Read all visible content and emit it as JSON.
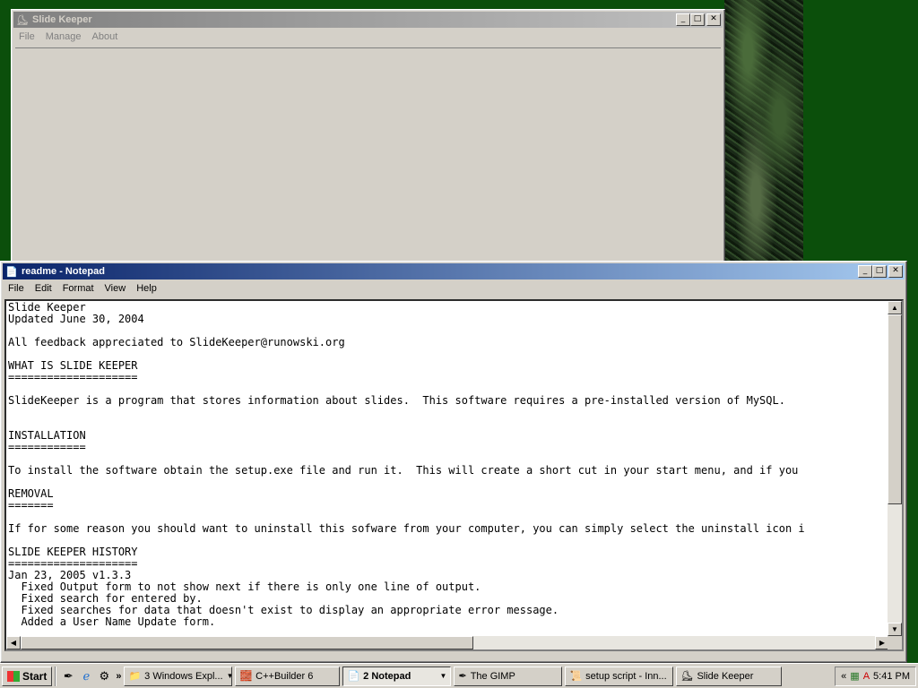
{
  "slide_keeper": {
    "title": "Slide Keeper",
    "menu": [
      "File",
      "Manage",
      "About"
    ]
  },
  "notepad": {
    "title": "readme - Notepad",
    "menu": [
      "File",
      "Edit",
      "Format",
      "View",
      "Help"
    ],
    "lines": [
      "Slide Keeper",
      "Updated June 30, 2004",
      "",
      "All feedback appreciated to SlideKeeper@runowski.org",
      "",
      "WHAT IS SLIDE KEEPER",
      "====================",
      "",
      "SlideKeeper is a program that stores information about slides.  This software requires a pre-installed version of MySQL.",
      "",
      "",
      "INSTALLATION",
      "============",
      "",
      "To install the software obtain the setup.exe file and run it.  This will create a short cut in your start menu, and if you",
      "",
      "REMOVAL",
      "=======",
      "",
      "If for some reason you should want to uninstall this sofware from your computer, you can simply select the uninstall icon i",
      "",
      "SLIDE KEEPER HISTORY",
      "====================",
      "Jan 23, 2005 v1.3.3",
      "  Fixed Output form to not show next if there is only one line of output.",
      "  Fixed search for entered by.",
      "  Fixed searches for data that doesn't exist to display an appropriate error message.",
      "  Added a User Name Update form."
    ]
  },
  "taskbar": {
    "start_label": "Start",
    "tasks": [
      {
        "label": "3 Windows Expl...",
        "icon": "folder-icon"
      },
      {
        "label": "C++Builder 6",
        "icon": "builder-icon"
      },
      {
        "label": "2 Notepad",
        "icon": "notepad-icon"
      },
      {
        "label": "The GIMP",
        "icon": "gimp-icon"
      },
      {
        "label": "setup script - Inn...",
        "icon": "setup-icon"
      },
      {
        "label": "Slide Keeper",
        "icon": "slide-keeper-icon"
      }
    ],
    "clock": "5:41 PM",
    "tray_chevron": "«"
  },
  "window_buttons": {
    "minimize": "_",
    "maximize": "□",
    "close": "✕"
  }
}
